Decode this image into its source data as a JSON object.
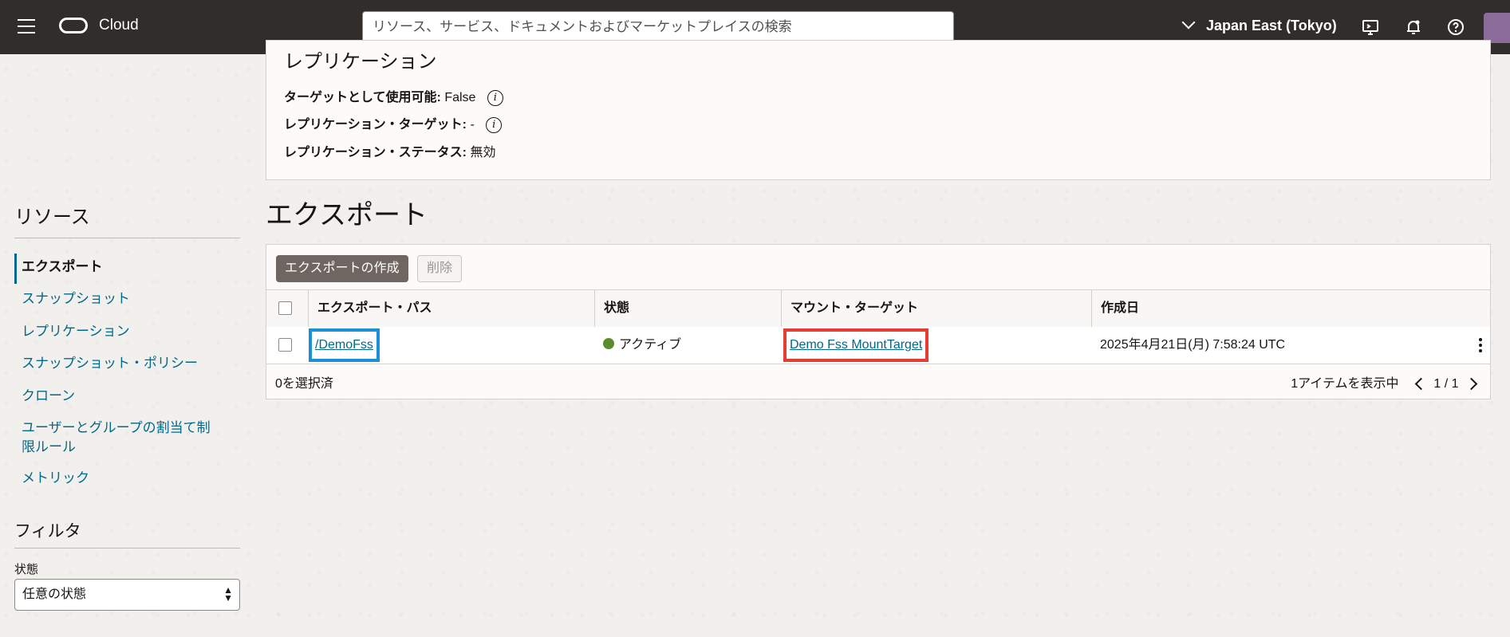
{
  "header": {
    "brand": "Cloud",
    "search_placeholder": "リソース、サービス、ドキュメントおよびマーケットプレイスの検索",
    "region": "Japan East (Tokyo)"
  },
  "replication": {
    "title": "レプリケーション",
    "target_usable_label": "ターゲットとして使用可能:",
    "target_usable_value": "False",
    "replication_target_label": "レプリケーション・ターゲット:",
    "replication_target_value": "-",
    "replication_status_label": "レプリケーション・ステータス:",
    "replication_status_value": "無効",
    "info_glyph": "i"
  },
  "exports": {
    "heading": "エクスポート",
    "create_button": "エクスポートの作成",
    "delete_button": "削除",
    "columns": [
      "エクスポート・パス",
      "状態",
      "マウント・ターゲット",
      "作成日"
    ],
    "rows": [
      {
        "path": "/DemoFss",
        "state": "アクティブ",
        "mount_target": "Demo Fss MountTarget",
        "created": "2025年4月21日(月) 7:58:24 UTC"
      }
    ],
    "selected_text": "0を選択済",
    "showing_text": "1アイテムを表示中",
    "page_text": "1 / 1",
    "state_color": "#5a8c2b"
  },
  "sidebar": {
    "resources_title": "リソース",
    "items": [
      {
        "label": "エクスポート"
      },
      {
        "label": "スナップショット"
      },
      {
        "label": "レプリケーション"
      },
      {
        "label": "スナップショット・ポリシー"
      },
      {
        "label": "クローン"
      },
      {
        "label": "ユーザーとグループの割当て制限ルール"
      },
      {
        "label": "メトリック"
      }
    ],
    "filter_title": "フィルタ",
    "state_label": "状態",
    "state_value": "任意の状態"
  },
  "highlights": {
    "path_box_color": "#1a91d6",
    "mount_target_box_color": "#e53d31"
  }
}
